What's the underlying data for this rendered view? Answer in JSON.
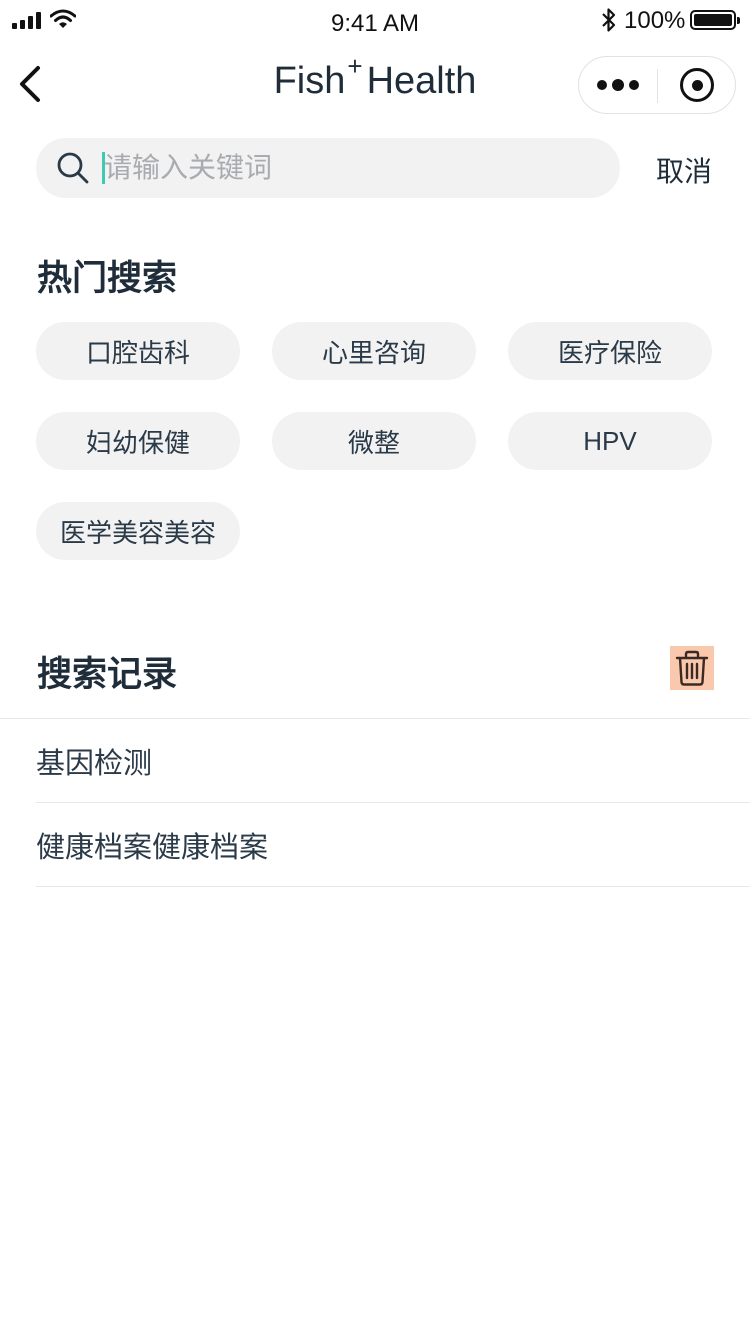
{
  "status_bar": {
    "time": "9:41 AM",
    "battery": "100%",
    "icons": [
      "signal-icon",
      "wifi-icon",
      "bluetooth-icon",
      "battery-icon"
    ]
  },
  "nav": {
    "title_main": "Fish",
    "title_sup": "+",
    "title_rest": "Health",
    "back_icon": "chevron-left-icon",
    "more_icon": "more-dots-icon",
    "close_icon": "target-close-icon"
  },
  "search": {
    "placeholder": "请输入关键词",
    "value": "",
    "cancel_label": "取消",
    "icon": "search-icon",
    "accent_color": "#3fc8b4"
  },
  "hot_search": {
    "title": "热门搜索",
    "tags": [
      "口腔齿科",
      "心里咨询",
      "医疗保险",
      "妇幼保健",
      "微整",
      "HPV",
      "医学美容美容"
    ]
  },
  "history": {
    "title": "搜索记录",
    "clear_icon": "trash-icon",
    "clear_bg_color": "#fac8ad",
    "items": [
      "基因检测",
      "健康档案健康档案"
    ]
  }
}
